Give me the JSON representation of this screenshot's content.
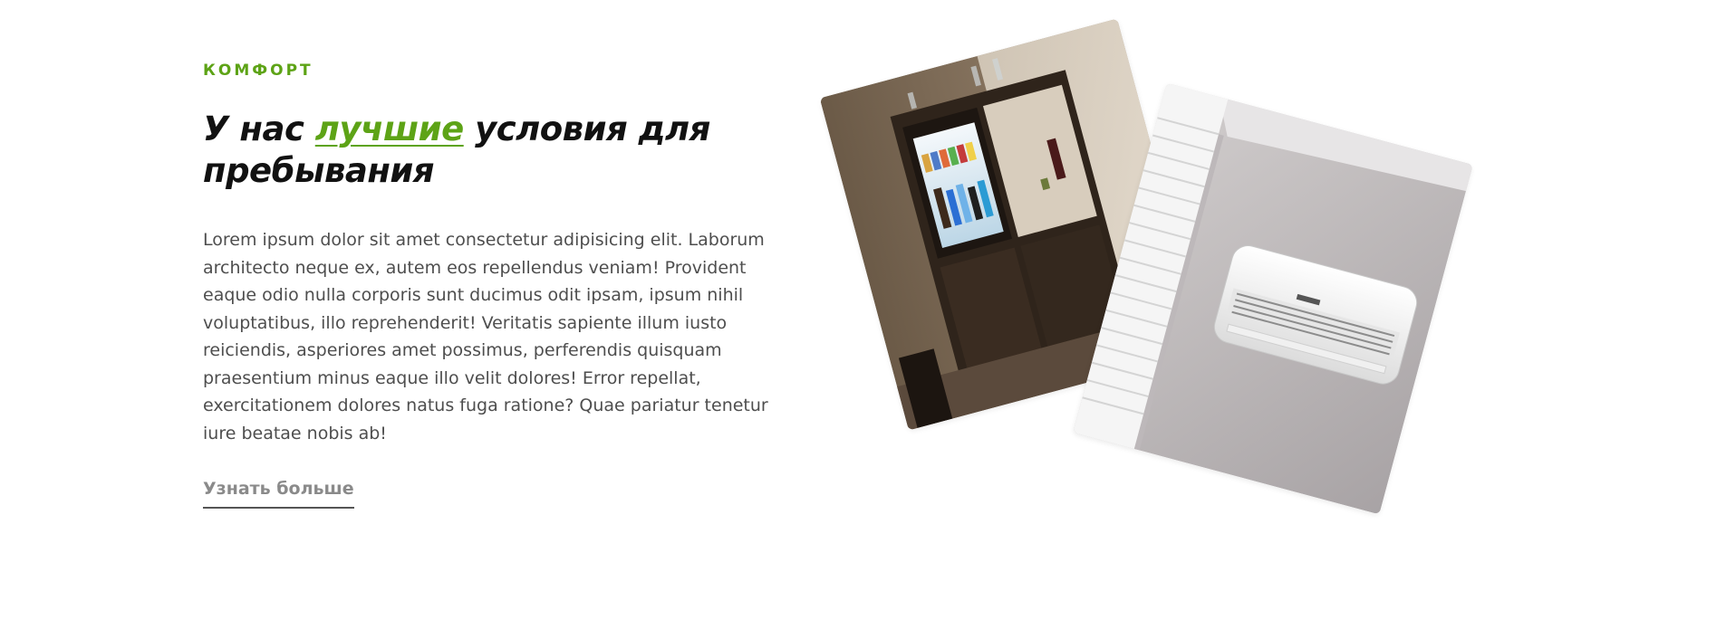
{
  "feature": {
    "eyebrow": "КОМФОРТ",
    "heading_before": "У нас ",
    "heading_accent": "лучшие",
    "heading_after": " условия для пребывания",
    "body": "Lorem ipsum dolor sit amet consectetur adipisicing elit. Laborum architecto neque ex, autem eos repellendus veniam! Provident eaque odio nulla corporis sunt ducimus odit ipsam, ipsum nihil voluptatibus, illo reprehenderit! Veritatis sapiente illum iusto reiciendis, asperiores amet possimus, perferendis quisquam praesentium minus eaque illo velit dolores! Error repellat, exercitationem dolores natus fuga ratione? Quae pariatur tenetur iure beatae nobis ab!",
    "cta_label": "Узнать больше"
  },
  "images": {
    "minibar": "minibar-photo",
    "air_conditioner": "air-conditioner-photo"
  },
  "colors": {
    "accent": "#5da316",
    "heading": "#111111",
    "body": "#4e4e4e",
    "link": "#8a8a8a"
  }
}
